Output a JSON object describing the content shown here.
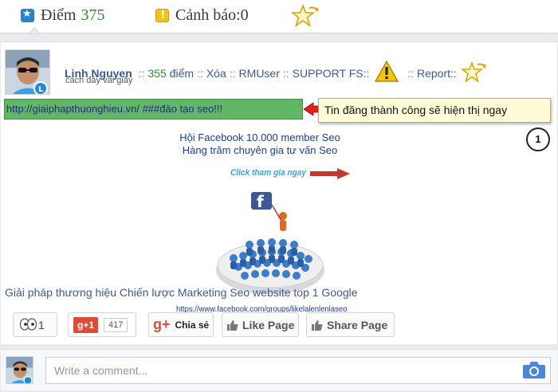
{
  "topbar": {
    "points_label": "Điểm",
    "points_value": "375",
    "warning_label": "Cảnh báo:",
    "warning_value": "0"
  },
  "post": {
    "author": "Linh Nguyen",
    "sep1": "::",
    "points_value": "355",
    "points_unit": "điểm",
    "sep2": "::",
    "delete": "Xóa",
    "sep3": "::",
    "rmuser": "RMUser",
    "sep4": "::",
    "support": "SUPPORT FS::",
    "sep5": "::",
    "report": "Report::",
    "time": "cách đây vài giây",
    "highlighted_text": "http://giaiphapthuonghieu.vn/ ###đào tạo seo!!!",
    "callout": "Tin đăng thành công sẽ hiện thị ngay",
    "callout_number": "1",
    "promo": {
      "line1": "Hội Facebook 10.000 member Seo",
      "line2": "Hàng trăm chuyên gia tư vấn Seo",
      "click": "Click tham gia ngay",
      "url": "https://www.facebook.com/groups/likelalenlenlaseo"
    },
    "description": "Giải pháp thương hiệu Chiến lược Marketing Seo website top 1 Google"
  },
  "share": {
    "pleased_count": "1",
    "gplus_chip": "g+1",
    "gplus_count": "417",
    "gplus_share_icon": "g+",
    "gplus_share": "Chia sẻ",
    "like_page": "Like Page",
    "share_page": "Share Page"
  },
  "comment": {
    "placeholder": "Write a comment..."
  },
  "colors": {
    "accent_blue": "#3b5a9a",
    "points_green": "#2e8b2e",
    "highlight_green": "#61b766",
    "callout_yellow": "#fffbd6",
    "gplus_red": "#dd4b39"
  },
  "icons": {
    "points": "star-badge-icon",
    "warning": "warning-icon",
    "favorite": "star-arrow-icon",
    "camera": "camera-icon",
    "thumb": "thumbs-up-icon"
  }
}
